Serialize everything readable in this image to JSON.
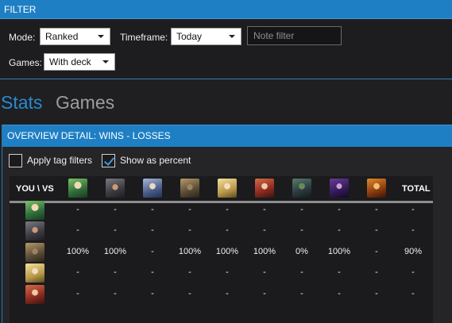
{
  "filter": {
    "title": "FILTER",
    "mode_label": "Mode:",
    "mode_value": "Ranked",
    "timeframe_label": "Timeframe:",
    "timeframe_value": "Today",
    "note_placeholder": "Note filter",
    "games_label": "Games:",
    "games_value": "With deck"
  },
  "tabs": {
    "stats": "Stats",
    "games": "Games"
  },
  "overview": {
    "title": "OVERVIEW DETAIL: WINS - LOSSES",
    "apply_tag_filters": {
      "label": "Apply tag filters",
      "checked": false
    },
    "show_as_percent": {
      "label": "Show as percent",
      "checked": true
    },
    "corner_header": "YOU \\ VS",
    "total_header": "TOTAL",
    "column_heroes": [
      "druid",
      "warrior",
      "mage",
      "rogue",
      "priest",
      "hunter",
      "shaman",
      "warlock",
      "paladin"
    ],
    "row_heroes": [
      "druid",
      "warrior",
      "rogue",
      "priest",
      "hunter"
    ],
    "rows": [
      [
        "-",
        "-",
        "-",
        "-",
        "-",
        "-",
        "-",
        "-",
        "-",
        "-"
      ],
      [
        "-",
        "-",
        "-",
        "-",
        "-",
        "-",
        "-",
        "-",
        "-",
        "-"
      ],
      [
        "100%",
        "100%",
        "-",
        "100%",
        "100%",
        "100%",
        "0%",
        "100%",
        "-",
        "90%"
      ],
      [
        "-",
        "-",
        "-",
        "-",
        "-",
        "-",
        "-",
        "-",
        "-",
        "-"
      ],
      [
        "-",
        "-",
        "-",
        "-",
        "-",
        "-",
        "-",
        "-",
        "-",
        "-"
      ]
    ]
  },
  "colors": {
    "accent": "#1e7fc4",
    "tab_active": "#2a8ad0",
    "tab_inactive": "#9c9c9c",
    "background": "#1f1f22"
  }
}
